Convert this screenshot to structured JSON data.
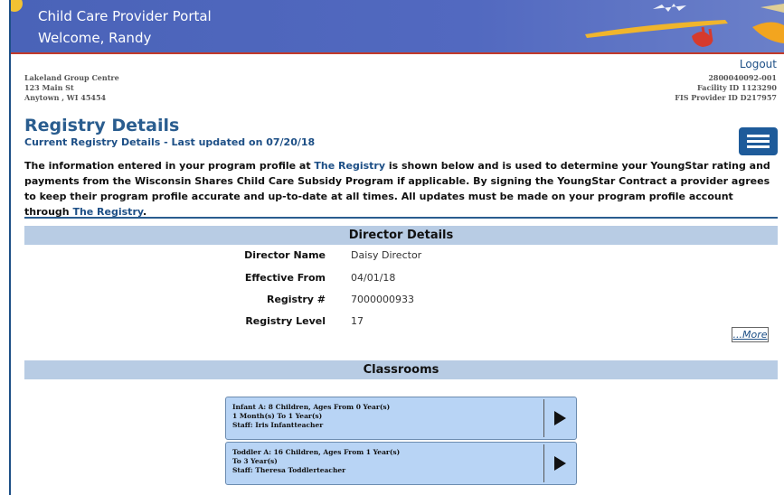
{
  "header": {
    "title": "Child Care Provider Portal",
    "welcome": "Welcome, Randy"
  },
  "logout_label": "Logout",
  "facility": {
    "name": "Lakeland Group Centre",
    "street": "123 Main St",
    "city": "Anytown , WI 45454"
  },
  "ids": {
    "account": "2800040092-001",
    "facility_id": "Facility ID 1123290",
    "fis_provider_id": "FIS Provider ID D217957"
  },
  "page": {
    "title": "Registry Details",
    "subtitle": "Current Registry Details - Last updated on 07/20/18"
  },
  "intro": {
    "part1": "The information entered in your program profile at ",
    "link1": "The Registry",
    "part2": " is shown below and is used to determine your YoungStar rating and payments from the Wisconsin Shares Child Care Subsidy Program if applicable. By signing the YoungStar Contract a provider agrees to keep their program profile accurate and up-to-date at all times. All updates must be made on your program profile account through ",
    "link2": "The Registry",
    "part3": "."
  },
  "director": {
    "section_title": "Director Details",
    "rows": [
      {
        "label": "Director Name",
        "value": "Daisy Director"
      },
      {
        "label": "Effective From",
        "value": "04/01/18"
      },
      {
        "label": "Registry #",
        "value": "7000000933"
      },
      {
        "label": "Registry Level",
        "value": "17"
      }
    ],
    "more_label": "...More"
  },
  "classrooms": {
    "section_title": "Classrooms",
    "items": [
      {
        "line1": "Infant A: 8 Children, Ages From 0 Year(s)",
        "line2": "1 Month(s) To 1 Year(s)",
        "line3": "Staff: Iris Infantteacher"
      },
      {
        "line1": "Toddler A: 16 Children, Ages From 1 Year(s)",
        "line2": "To 3 Year(s)",
        "line3": "Staff: Theresa Toddlerteacher"
      }
    ]
  },
  "icons": {
    "menu": "hamburger-menu-icon",
    "expand": "play-arrow-icon",
    "banner_sun": "sun-icon"
  },
  "colors": {
    "banner": "#4a63b8",
    "accent": "#1d4f86",
    "section_bar": "#b8cce4",
    "card": "#b8d4f5"
  }
}
